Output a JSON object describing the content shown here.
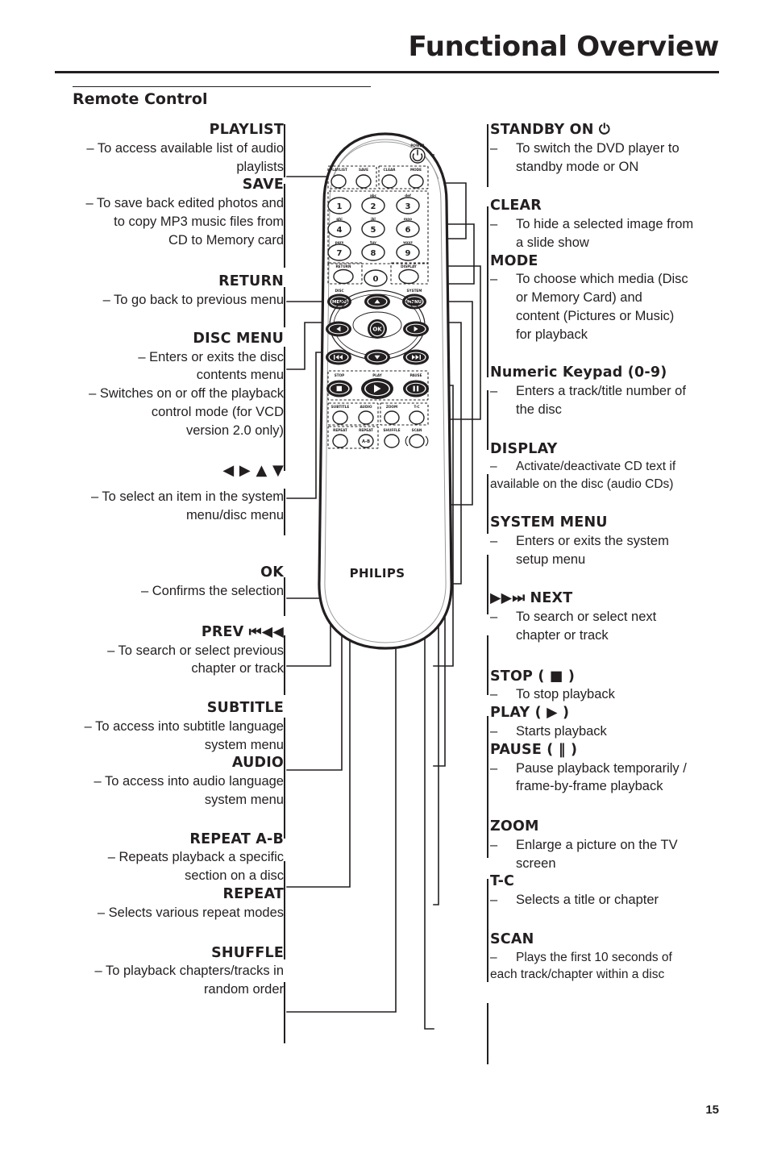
{
  "header": {
    "title": "Functional Overview",
    "section": "Remote Control",
    "page_number": "15"
  },
  "left_column": [
    {
      "heading": "PLAYLIST",
      "lines": [
        "–  To access available list of audio",
        "playlists"
      ]
    },
    {
      "heading": "SAVE",
      "lines": [
        "–  To save back edited photos and",
        "to copy MP3 music files from",
        "CD to Memory card"
      ]
    },
    {
      "heading": "RETURN",
      "lines": [
        "–  To go back to previous menu"
      ]
    },
    {
      "heading": "DISC MENU",
      "lines": [
        "– Enters or exits the disc",
        "contents menu",
        "– Switches on or off the playback",
        "control mode (for VCD",
        "version 2.0 only)"
      ]
    },
    {
      "heading": "◀ ▶  ▲ ▼",
      "lines": [
        "– To select an item in the system",
        "menu/disc menu"
      ]
    },
    {
      "heading": "OK",
      "lines": [
        "– Confirms the selection"
      ]
    },
    {
      "heading": "PREV ⏮◀◀",
      "lines": [
        "– To search or select previous",
        "chapter or track"
      ]
    },
    {
      "heading": "SUBTITLE",
      "lines": [
        "– To access into subtitle language",
        "system menu"
      ]
    },
    {
      "heading": "AUDIO",
      "lines": [
        "– To access into audio language",
        "system menu"
      ]
    },
    {
      "heading": "REPEAT A-B",
      "lines": [
        "– Repeats playback a specific",
        "section on a disc"
      ]
    },
    {
      "heading": "REPEAT",
      "lines": [
        "– Selects various repeat modes"
      ]
    },
    {
      "heading": "SHUFFLE",
      "lines": [
        "– To playback chapters/tracks in",
        "random order"
      ]
    }
  ],
  "right_column": [
    {
      "heading": "STANDBY ON ⏻",
      "lines": [
        "To switch the DVD player to",
        "standby mode or ON"
      ]
    },
    {
      "heading": "CLEAR",
      "lines": [
        "To hide a selected image from",
        "a slide show"
      ]
    },
    {
      "heading": "MODE",
      "lines": [
        "To choose which media (Disc",
        "or Memory Card) and",
        "content (Pictures or Music)",
        "for playback"
      ]
    },
    {
      "heading": "Numeric Keypad (0-9)",
      "lines": [
        "Enters a track/title number of",
        "the disc"
      ]
    },
    {
      "heading": "DISPLAY",
      "lines": [
        "Activate/deactivate CD text if",
        "available on the disc (audio CDs)"
      ]
    },
    {
      "heading": "SYSTEM MENU",
      "lines": [
        "Enters or exits the system",
        "setup menu"
      ]
    },
    {
      "heading": "▶▶⏭  NEXT",
      "lines": [
        "To search or select next",
        "chapter or track"
      ]
    },
    {
      "heading": "STOP ( ■ )",
      "lines": [
        "To stop playback"
      ]
    },
    {
      "heading": "PLAY ( ▶ )",
      "lines": [
        "Starts playback"
      ]
    },
    {
      "heading": "PAUSE ( ‖ )",
      "lines": [
        "Pause playback temporarily /",
        "frame-by-frame playback"
      ]
    },
    {
      "heading": "ZOOM",
      "lines": [
        "Enlarge a picture on the TV",
        "screen"
      ]
    },
    {
      "heading": "T-C",
      "lines": [
        "Selects a title or chapter"
      ]
    },
    {
      "heading": "SCAN",
      "lines": [
        "Plays the first 10 seconds of",
        "each track/chapter within a disc"
      ]
    }
  ],
  "remote": {
    "brand": "PHILIPS",
    "power_label": "POWER",
    "top_row": [
      "PLAYLIST",
      "SAVE",
      "CLEAR",
      "MODE"
    ],
    "keypad": [
      {
        "digit": "1",
        "letters": ""
      },
      {
        "digit": "2",
        "letters": "abc"
      },
      {
        "digit": "3",
        "letters": "def"
      },
      {
        "digit": "4",
        "letters": "ghi"
      },
      {
        "digit": "5",
        "letters": "jkl"
      },
      {
        "digit": "6",
        "letters": "mno"
      },
      {
        "digit": "7",
        "letters": "pqrs"
      },
      {
        "digit": "8",
        "letters": "tuv"
      },
      {
        "digit": "9",
        "letters": "wxyz"
      },
      {
        "digit": "0",
        "letters": ""
      }
    ],
    "return_label": "RETURN",
    "display_label": "DISPLAY",
    "disc_label": "DISC",
    "system_label": "SYSTEM",
    "menu_label": "MENU",
    "ok_label": "OK",
    "transport": [
      "STOP",
      "PLAY",
      "PAUSE"
    ],
    "fn_row1": [
      "SUBTITLE",
      "AUDIO",
      "ZOOM",
      "T-C"
    ],
    "fn_row2": [
      "REPEAT",
      "REPEAT",
      "SHUFFLE",
      "SCAN"
    ],
    "ab_label": "A-B"
  }
}
